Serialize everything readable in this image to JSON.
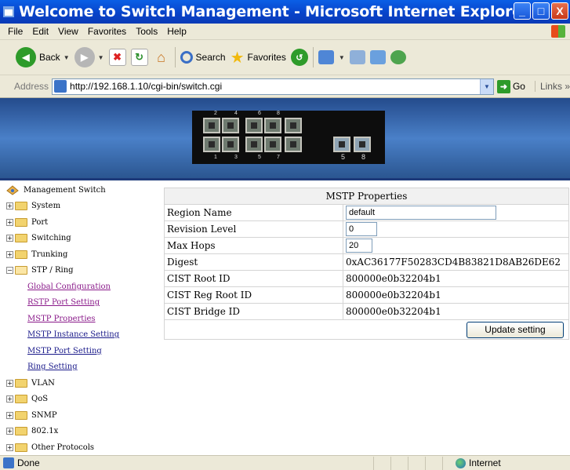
{
  "window": {
    "title": "Welcome to Switch Management - Microsoft Internet Explorer",
    "buttons": [
      "_",
      "□",
      "X"
    ]
  },
  "menubar": [
    "File",
    "Edit",
    "View",
    "Favorites",
    "Tools",
    "Help"
  ],
  "toolbar": {
    "back_label": "Back",
    "search_label": "Search",
    "favorites_label": "Favorites"
  },
  "addressbar": {
    "label": "Address",
    "url": "http://192.168.1.10/cgi-bin/switch.cgi",
    "go_label": "Go",
    "links_label": "Links »"
  },
  "banner": {
    "port_labels": [
      "2",
      "4",
      "6",
      "8",
      "1",
      "3",
      "5",
      "7",
      "5",
      "8"
    ]
  },
  "tree": {
    "root": "Management Switch",
    "items": [
      {
        "label": "System",
        "expanded": false
      },
      {
        "label": "Port",
        "expanded": false
      },
      {
        "label": "Switching",
        "expanded": false
      },
      {
        "label": "Trunking",
        "expanded": false
      },
      {
        "label": "STP / Ring",
        "expanded": true
      },
      {
        "label": "VLAN",
        "expanded": false
      },
      {
        "label": "QoS",
        "expanded": false
      },
      {
        "label": "SNMP",
        "expanded": false
      },
      {
        "label": "802.1x",
        "expanded": false
      },
      {
        "label": "Other Protocols",
        "expanded": false
      }
    ],
    "stp_children": [
      "Global Configuration",
      "RSTP Port Setting",
      "MSTP Properties",
      "MSTP Instance Setting",
      "MSTP Port Setting",
      "Ring Setting"
    ]
  },
  "mstp": {
    "header": "MSTP Properties",
    "region_name_label": "Region Name",
    "region_name_value": "default",
    "revision_level_label": "Revision Level",
    "revision_level_value": "0",
    "max_hops_label": "Max Hops",
    "max_hops_value": "20",
    "digest_label": "Digest",
    "digest_value": "0xAC36177F50283CD4B83821D8AB26DE62",
    "cist_root_id_label": "CIST Root ID",
    "cist_root_id_value": "800000e0b32204b1",
    "cist_reg_root_id_label": "CIST Reg Root ID",
    "cist_reg_root_id_value": "800000e0b32204b1",
    "cist_bridge_id_label": "CIST Bridge ID",
    "cist_bridge_id_value": "800000e0b32204b1",
    "update_button": "Update setting"
  },
  "statusbar": {
    "status": "Done",
    "zone": "Internet"
  }
}
